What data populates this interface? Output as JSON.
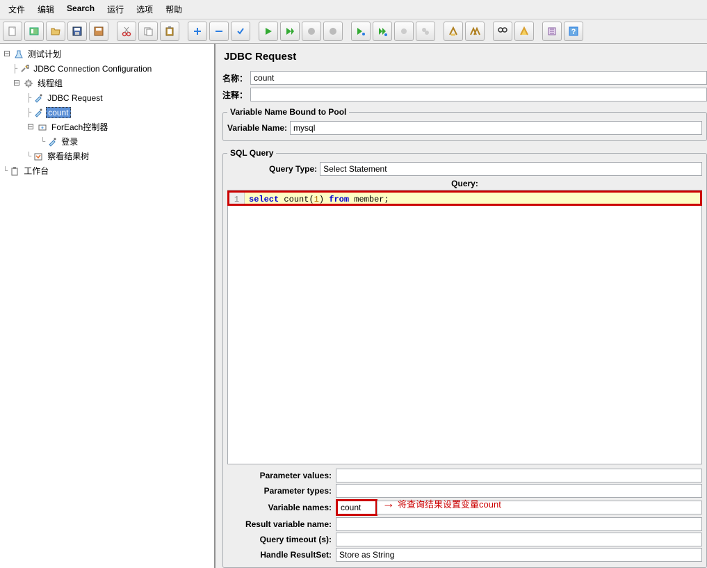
{
  "menu": {
    "file": "文件",
    "edit": "编辑",
    "search": "Search",
    "run": "运行",
    "options": "选项",
    "help": "帮助"
  },
  "tree": {
    "root": "测试计划",
    "jdbc_conn": "JDBC Connection Configuration",
    "thread_group": "线程组",
    "jdbc_req": "JDBC Request",
    "count": "count",
    "foreach": "ForEach控制器",
    "login": "登录",
    "view_results": "察看结果树",
    "workbench": "工作台"
  },
  "panel": {
    "title": "JDBC Request",
    "name_label": "名称：",
    "name_value": "count",
    "comment_label": "注释：",
    "comment_value": ""
  },
  "pool": {
    "legend": "Variable Name Bound to Pool",
    "var_name_label": "Variable Name:",
    "var_name_value": "mysql"
  },
  "sql": {
    "legend": "SQL Query",
    "query_type_label": "Query Type:",
    "query_type_value": "Select Statement",
    "query_header": "Query:",
    "line_no": "1",
    "code_kw1": "select",
    "code_fn": " count",
    "code_paren_open": "(",
    "code_num": "1",
    "code_paren_close": ")",
    "code_kw2": " from",
    "code_tbl": " member",
    "code_semi": ";"
  },
  "params": {
    "param_values_label": "Parameter values:",
    "param_values_value": "",
    "param_types_label": "Parameter types:",
    "param_types_value": "",
    "var_names_label": "Variable names:",
    "var_names_value": "count",
    "result_var_label": "Result variable name:",
    "result_var_value": "",
    "timeout_label": "Query timeout (s):",
    "timeout_value": "",
    "handle_rs_label": "Handle ResultSet:",
    "handle_rs_value": "Store as String"
  },
  "annotation": {
    "text": "将查询结果设置变量count"
  }
}
